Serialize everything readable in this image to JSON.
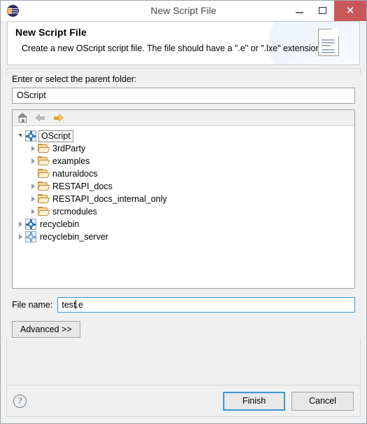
{
  "window": {
    "title": "New Script File",
    "icon": "opentext-logo-icon",
    "minimize_label": "Minimize",
    "maximize_label": "Maximize",
    "close_label": "Close"
  },
  "header": {
    "title": "New Script File",
    "description": "Create a new OScript script file. The file should have a \".e\" or \".lxe\" extension.",
    "icon": "new-document-icon"
  },
  "parent_folder": {
    "label": "Enter or select the parent folder:",
    "value": "OScript"
  },
  "tree_toolbar": {
    "home": "home-icon",
    "back": "back-arrow-icon",
    "forward": "forward-arrow-icon"
  },
  "tree": {
    "items": [
      {
        "label": "OScript",
        "icon": "project-icon",
        "twisty": "open",
        "indent": 0,
        "selected": true
      },
      {
        "label": "3rdParty",
        "icon": "folder-icon",
        "twisty": "closed",
        "indent": 1,
        "selected": false
      },
      {
        "label": "examples",
        "icon": "folder-icon",
        "twisty": "closed",
        "indent": 1,
        "selected": false
      },
      {
        "label": "naturaldocs",
        "icon": "folder-icon",
        "twisty": "none",
        "indent": 1,
        "selected": false
      },
      {
        "label": "RESTAPI_docs",
        "icon": "folder-icon",
        "twisty": "closed",
        "indent": 1,
        "selected": false
      },
      {
        "label": "RESTAPI_docs_internal_only",
        "icon": "folder-icon",
        "twisty": "closed",
        "indent": 1,
        "selected": false
      },
      {
        "label": "srcmodules",
        "icon": "folder-icon",
        "twisty": "closed",
        "indent": 1,
        "selected": false
      },
      {
        "label": "recyclebin",
        "icon": "project-icon",
        "twisty": "closed",
        "indent": 0,
        "selected": false
      },
      {
        "label": "recyclebin_server",
        "icon": "project-closed-icon",
        "twisty": "closed",
        "indent": 0,
        "selected": false
      }
    ]
  },
  "filename": {
    "label": "File name:",
    "value_before_caret": "test",
    "value_after_caret": ".e",
    "full_value": "test.e"
  },
  "advanced": {
    "label": "Advanced >>"
  },
  "footer": {
    "help": "help-icon",
    "finish_label": "Finish",
    "cancel_label": "Cancel"
  },
  "colors": {
    "accent_blue": "#3f95d5",
    "close_red": "#c9585b",
    "folder_gold": "#e2a33a",
    "project_blue": "#2a6fb5",
    "body_gray": "#f0f0f0"
  }
}
